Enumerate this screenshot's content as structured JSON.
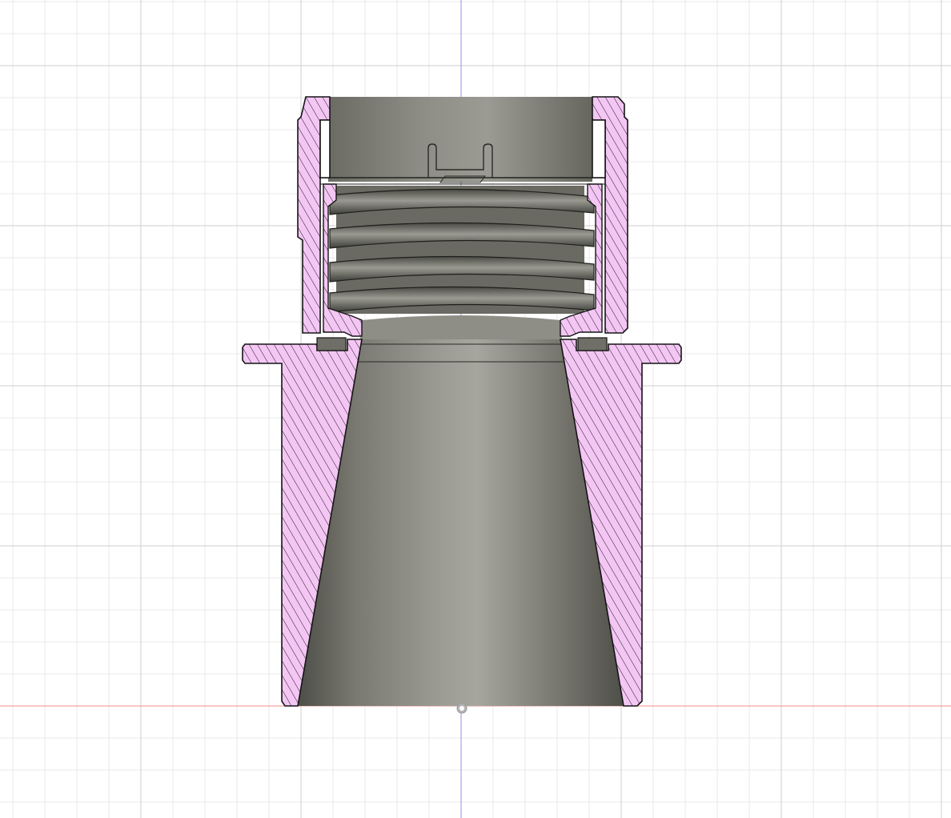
{
  "viewport": {
    "background": "#ffffff",
    "grid_minor_color": "#e8e8e8",
    "grid_major_color": "#cfcfcf",
    "vertical_axis_color": "#8f8fe6",
    "horizontal_axis_color": "#ef8f8f"
  },
  "section_view": {
    "cut_face_fill": "#f4c6f4",
    "hatch_color": "#1a1a1a",
    "interior_shade_dark": "#5f5f57",
    "interior_shade_light": "#a9a9a1",
    "outline_color": "#151515"
  },
  "origin_marker": {
    "icon": "origin-point-icon",
    "color": "#b4b4b4"
  }
}
